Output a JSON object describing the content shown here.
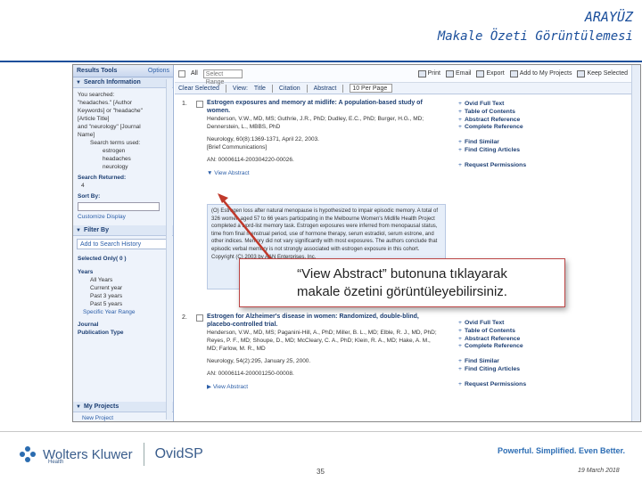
{
  "slide": {
    "title_line1": "ARAYÜZ",
    "title_line2": "Makale Özeti Görüntülemesi",
    "page_number": "35",
    "date": "19 March 2018"
  },
  "sidebar": {
    "results_tools": "Results Tools",
    "options": "Options",
    "search_info_header": "Search Information",
    "you_searched": [
      "You searched:",
      "\"headaches.\" [Author",
      "Keywords] or \"headache\"",
      "[Article Title]",
      "and \"neurology\" [Journal",
      "Name]"
    ],
    "search_terms_label": "Search terms used:",
    "search_terms": [
      "estrogen",
      "headaches",
      "neurology"
    ],
    "search_returned_label": "Search Returned:",
    "search_returned_value": "4",
    "sort_by_label": "Sort By:",
    "customize_display": "Customize Display",
    "filter_header": "Filter By",
    "add_to_search_history": "Add to Search History",
    "selected_only": "Selected Only( 0 )",
    "years_label": "Years",
    "years_options": [
      "All Years",
      "Current year",
      "Past 3 years",
      "Past 5 years"
    ],
    "specific_year_range": "Specific Year Range",
    "journal_label": "Journal",
    "publication_type_label": "Publication Type",
    "my_projects_header": "My Projects",
    "new_project": "New Project"
  },
  "toolbar": {
    "all_label": "All",
    "select_range_placeholder": "Select Range",
    "print": "Print",
    "email": "Email",
    "export": "Export",
    "add_to_my_projects": "Add to My Projects",
    "keep_selected": "Keep Selected",
    "clear_selected": "Clear Selected",
    "view_label": "View:",
    "title_view": "Title",
    "citation_view": "Citation",
    "abstract_view": "Abstract",
    "per_page": "10 Per Page"
  },
  "results": [
    {
      "number": "1.",
      "title": "Estrogen exposures and memory at midlife: A population-based study of women.",
      "authors": "Henderson, V.W., MD, MS; Guthrie, J.R., PhD; Dudley, E.C., PhD; Burger, H.G., MD; Dennerstein, L., MBBS, PhD",
      "journal": "Neurology, 60(8):1369-1371, April 22, 2003.",
      "article_type": "[Brief Communications]",
      "accession": "AN: 00006114-200304220-00026.",
      "view_abstract": "View Abstract",
      "abstract_text": "(O) Estrogen loss after natural menopause is hypothesized to impair episodic memory. A total of 326 women aged 57 to 66 years participating in the Melbourne Women's Midlife Health Project completed a word-list memory task. Estrogen exposures were inferred from menopausal status, time from final menstrual period, use of hormone therapy, serum estradiol, serum estrone, and other indices. Memory did not vary significantly with most exposures. The authors conclude that episodic verbal memory is not strongly associated with estrogen exposure in this cohort. Copyright (C) 2003 by AAN Enterprises, Inc.",
      "links": [
        "Ovid Full Text",
        "Table of Contents",
        "Abstract Reference",
        "Complete Reference"
      ],
      "links2": [
        "Find Similar",
        "Find Citing Articles"
      ],
      "links3": [
        "Request Permissions"
      ]
    },
    {
      "number": "2.",
      "title": "Estrogen for Alzheimer's disease in women: Randomized, double-blind, placebo-controlled trial.",
      "authors": "Henderson, V.W., MD, MS; Paganini-Hill, A., PhD; Miller, B. L., MD; Elble, R. J., MD, PhD; Reyes, P. F., MD; Shoupe, D., MD; McCleary, C. A., PhD; Klein, R. A., MD; Hake, A. M., MD; Farlow, M. R., MD",
      "journal": "Neurology, 54(2):295, January 25, 2000.",
      "accession": "AN: 00006114-200001250-00008.",
      "view_abstract": "View Abstract",
      "links": [
        "Ovid Full Text",
        "Table of Contents",
        "Abstract Reference",
        "Complete Reference"
      ],
      "links2": [
        "Find Similar",
        "Find Citing Articles"
      ],
      "links3": [
        "Request Permissions"
      ]
    }
  ],
  "callout": {
    "line1": "“View Abstract” butonuna tıklayarak",
    "line2": "makale özetini görüntüleyebilirsiniz."
  },
  "footer": {
    "brand": "Wolters Kluwer",
    "brand_sub": "Health",
    "product": "OvidSP",
    "tagline": "Powerful. Simplified. Even Better."
  },
  "colors": {
    "accent": "#1b4f9b",
    "link": "#2b5ea8",
    "callout_arrow": "#c0392b"
  }
}
